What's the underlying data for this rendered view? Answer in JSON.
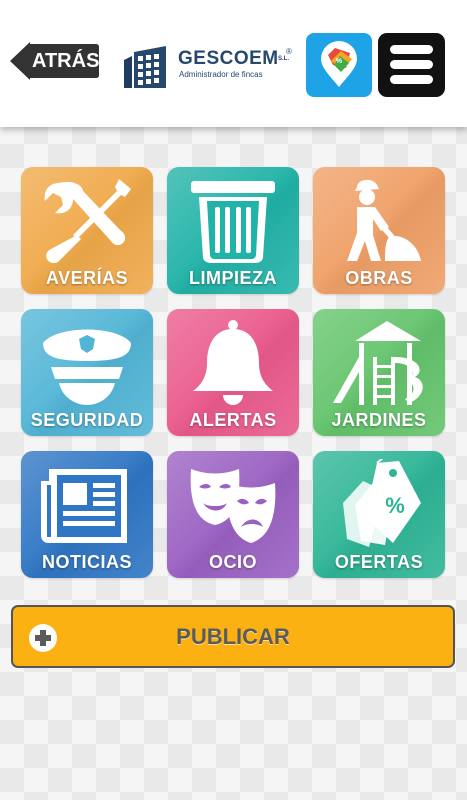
{
  "header": {
    "back_label": "ATRÁS",
    "logo_name": "GESCOEM",
    "logo_suffix": "S.L.",
    "logo_registered": "®",
    "logo_subtitle": "Administrador de fincas",
    "offers_icon": "price-tag-map-pin-icon",
    "menu_icon": "hamburger-menu-icon"
  },
  "tiles": [
    {
      "label": "AVERÍAS",
      "icon": "wrench-screwdriver-icon",
      "color": "#f0a94a"
    },
    {
      "label": "LIMPIEZA",
      "icon": "trash-bin-icon",
      "color": "#21b3a8"
    },
    {
      "label": "OBRAS",
      "icon": "construction-worker-icon",
      "color": "#f0a067"
    },
    {
      "label": "SEGURIDAD",
      "icon": "police-cap-icon",
      "color": "#52b5d6"
    },
    {
      "label": "ALERTAS",
      "icon": "bell-icon",
      "color": "#ea5a8c"
    },
    {
      "label": "JARDINES",
      "icon": "playground-slide-icon",
      "color": "#64c46c"
    },
    {
      "label": "NOTICIAS",
      "icon": "newspaper-icon",
      "color": "#2f76c4"
    },
    {
      "label": "OCIO",
      "icon": "theater-masks-icon",
      "color": "#9a61c2"
    },
    {
      "label": "OFERTAS",
      "icon": "discount-tags-icon",
      "color": "#2eb596"
    }
  ],
  "publish": {
    "label": "PUBLICAR",
    "icon": "plus-circle-icon",
    "color": "#fbb112"
  }
}
